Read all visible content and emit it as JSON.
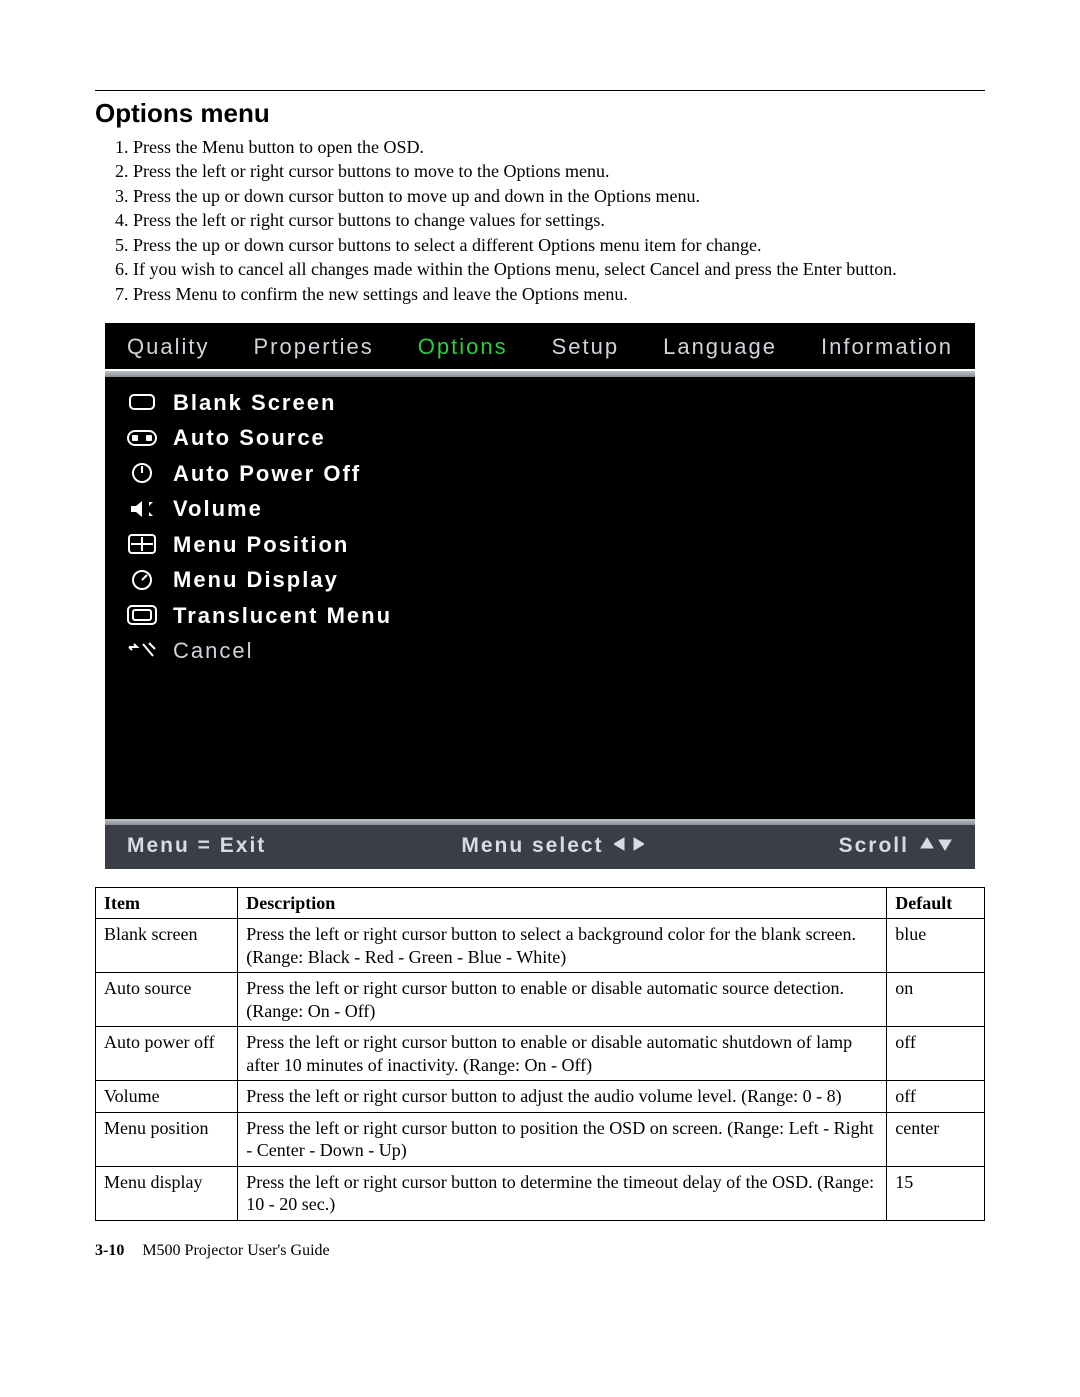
{
  "heading": "Options menu",
  "steps": [
    "Press the Menu button to open the OSD.",
    "Press the left or right cursor buttons to move to the Options menu.",
    "Press the up or down cursor button to move up and down in the Options menu.",
    "Press the left or right cursor buttons to change values for settings.",
    "Press the up or down cursor buttons to select a different Options menu item for change.",
    "If you wish to cancel all changes made within the Options menu, select Cancel and press the Enter button.",
    "Press Menu to confirm the new settings and leave the Options menu."
  ],
  "osd": {
    "tabs": [
      "Quality",
      "Properties",
      "Options",
      "Setup",
      "Language",
      "Information"
    ],
    "active_tab": 2,
    "items": [
      {
        "label": "Blank Screen",
        "icon": "blank-screen-icon"
      },
      {
        "label": "Auto Source",
        "icon": "auto-source-icon"
      },
      {
        "label": "Auto Power Off",
        "icon": "auto-poweroff-icon"
      },
      {
        "label": "Volume",
        "icon": "volume-icon"
      },
      {
        "label": "Menu Position",
        "icon": "menu-position-icon"
      },
      {
        "label": "Menu Display",
        "icon": "menu-display-icon"
      },
      {
        "label": "Translucent Menu",
        "icon": "translucent-menu-icon"
      },
      {
        "label": "Cancel",
        "icon": "cancel-icon"
      }
    ],
    "footer": {
      "exit": "Menu = Exit",
      "select": "Menu select",
      "scroll": "Scroll"
    }
  },
  "table": {
    "headers": {
      "item": "Item",
      "desc": "Description",
      "def": "Default"
    },
    "rows": [
      {
        "item": "Blank screen",
        "desc": "Press the left or right cursor button to select a background color for the blank screen. (Range: Black - Red - Green - Blue - White)",
        "def": "blue"
      },
      {
        "item": "Auto source",
        "desc": "Press the left or right cursor button to enable or disable automatic source detection. (Range: On - Off)",
        "def": "on"
      },
      {
        "item": "Auto power off",
        "desc": "Press the left or right cursor button to enable or disable automatic shutdown of lamp after 10 minutes of inactivity. (Range: On - Off)",
        "def": "off"
      },
      {
        "item": "Volume",
        "desc": "Press the left or right cursor button to adjust the audio volume level. (Range: 0 - 8)",
        "def": "off"
      },
      {
        "item": "Menu position",
        "desc": "Press the left or right cursor button to position the OSD on screen. (Range: Left - Right - Center - Down - Up)",
        "def": "center"
      },
      {
        "item": "Menu display",
        "desc": "Press the left or right cursor button to determine the timeout delay of the OSD. (Range: 10 - 20 sec.)",
        "def": "15"
      }
    ]
  },
  "page_footer": {
    "page_num": "3-10",
    "guide": "M500 Projector User's Guide"
  }
}
